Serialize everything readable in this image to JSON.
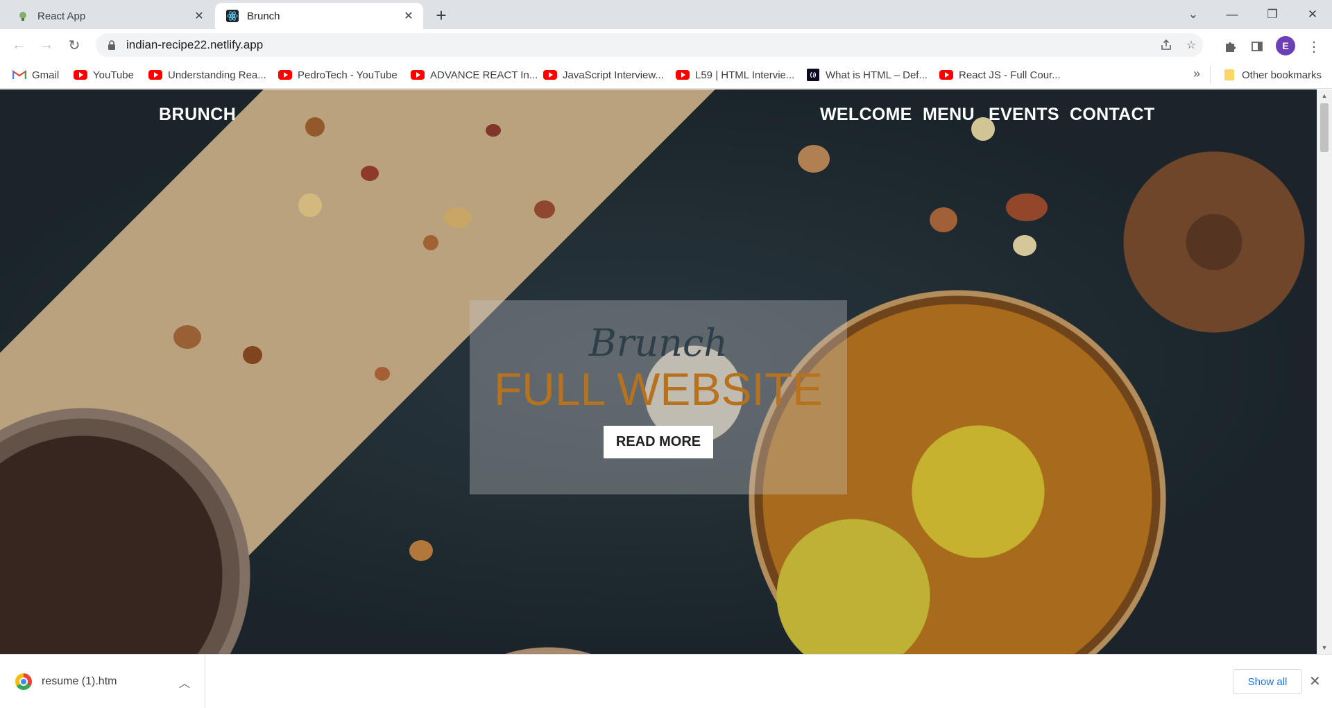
{
  "tabs": [
    {
      "title": "React App",
      "favicon": "react-app-icon"
    },
    {
      "title": "Brunch",
      "favicon": "react-logo-icon"
    }
  ],
  "omnibox": {
    "url": "indian-recipe22.netlify.app"
  },
  "profile": {
    "initial": "E",
    "color": "#6b3fb5"
  },
  "bookmarks": [
    {
      "label": "Gmail",
      "icon": "gmail-icon"
    },
    {
      "label": "YouTube",
      "icon": "youtube-icon"
    },
    {
      "label": "Understanding Rea...",
      "icon": "youtube-icon"
    },
    {
      "label": "PedroTech - YouTube",
      "icon": "youtube-icon"
    },
    {
      "label": "ADVANCE REACT In...",
      "icon": "youtube-icon"
    },
    {
      "label": "JavaScript Interview...",
      "icon": "youtube-icon"
    },
    {
      "label": "L59 | HTML Intervie...",
      "icon": "youtube-icon"
    },
    {
      "label": "What is HTML – Def...",
      "icon": "freecodecamp-icon"
    },
    {
      "label": "React JS - Full Cour...",
      "icon": "youtube-icon"
    }
  ],
  "other_bookmarks": "Other bookmarks",
  "bookmark_overflow": "»",
  "site": {
    "logo": "BRUNCH",
    "nav": [
      "WELCOME",
      "MENU",
      "EVENTS",
      "CONTACT"
    ],
    "hero": {
      "script": "Brunch",
      "headline": "FULL WEBSITE",
      "cta": "READ MORE"
    },
    "colors": {
      "headline": "#b7721f",
      "script": "#2e3f49"
    }
  },
  "downloads": {
    "file": "resume (1).htm",
    "show_all": "Show all"
  }
}
